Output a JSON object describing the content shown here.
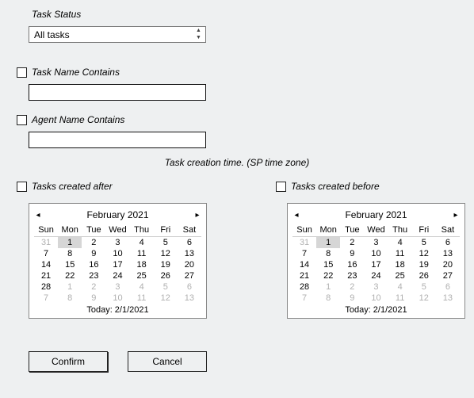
{
  "filters": {
    "task_status_label": "Task Status",
    "task_status_value": "All tasks",
    "task_name_contains_label": "Task Name Contains",
    "task_name_contains_value": "",
    "agent_name_contains_label": "Agent Name Contains",
    "agent_name_contains_value": "",
    "creation_time_caption": "Task creation time. (SP time zone)",
    "created_after_label": "Tasks created after",
    "created_before_label": "Tasks created before"
  },
  "calendar_after": {
    "title": "February 2021",
    "weekdays": [
      "Sun",
      "Mon",
      "Tue",
      "Wed",
      "Thu",
      "Fri",
      "Sat"
    ],
    "days": [
      {
        "n": "31",
        "other": true
      },
      {
        "n": "1",
        "sel": true
      },
      {
        "n": "2"
      },
      {
        "n": "3"
      },
      {
        "n": "4"
      },
      {
        "n": "5"
      },
      {
        "n": "6"
      },
      {
        "n": "7"
      },
      {
        "n": "8"
      },
      {
        "n": "9"
      },
      {
        "n": "10"
      },
      {
        "n": "11"
      },
      {
        "n": "12"
      },
      {
        "n": "13"
      },
      {
        "n": "14"
      },
      {
        "n": "15"
      },
      {
        "n": "16"
      },
      {
        "n": "17"
      },
      {
        "n": "18"
      },
      {
        "n": "19"
      },
      {
        "n": "20"
      },
      {
        "n": "21"
      },
      {
        "n": "22"
      },
      {
        "n": "23"
      },
      {
        "n": "24"
      },
      {
        "n": "25"
      },
      {
        "n": "26"
      },
      {
        "n": "27"
      },
      {
        "n": "28"
      },
      {
        "n": "1",
        "other": true
      },
      {
        "n": "2",
        "other": true
      },
      {
        "n": "3",
        "other": true
      },
      {
        "n": "4",
        "other": true
      },
      {
        "n": "5",
        "other": true
      },
      {
        "n": "6",
        "other": true
      },
      {
        "n": "7",
        "other": true
      },
      {
        "n": "8",
        "other": true
      },
      {
        "n": "9",
        "other": true
      },
      {
        "n": "10",
        "other": true
      },
      {
        "n": "11",
        "other": true
      },
      {
        "n": "12",
        "other": true
      },
      {
        "n": "13",
        "other": true
      }
    ],
    "footer": "Today: 2/1/2021"
  },
  "calendar_before": {
    "title": "February 2021",
    "weekdays": [
      "Sun",
      "Mon",
      "Tue",
      "Wed",
      "Thu",
      "Fri",
      "Sat"
    ],
    "days": [
      {
        "n": "31",
        "other": true
      },
      {
        "n": "1",
        "sel": true
      },
      {
        "n": "2"
      },
      {
        "n": "3"
      },
      {
        "n": "4"
      },
      {
        "n": "5"
      },
      {
        "n": "6"
      },
      {
        "n": "7"
      },
      {
        "n": "8"
      },
      {
        "n": "9"
      },
      {
        "n": "10"
      },
      {
        "n": "11"
      },
      {
        "n": "12"
      },
      {
        "n": "13"
      },
      {
        "n": "14"
      },
      {
        "n": "15"
      },
      {
        "n": "16"
      },
      {
        "n": "17"
      },
      {
        "n": "18"
      },
      {
        "n": "19"
      },
      {
        "n": "20"
      },
      {
        "n": "21"
      },
      {
        "n": "22"
      },
      {
        "n": "23"
      },
      {
        "n": "24"
      },
      {
        "n": "25"
      },
      {
        "n": "26"
      },
      {
        "n": "27"
      },
      {
        "n": "28"
      },
      {
        "n": "1",
        "other": true
      },
      {
        "n": "2",
        "other": true
      },
      {
        "n": "3",
        "other": true
      },
      {
        "n": "4",
        "other": true
      },
      {
        "n": "5",
        "other": true
      },
      {
        "n": "6",
        "other": true
      },
      {
        "n": "7",
        "other": true
      },
      {
        "n": "8",
        "other": true
      },
      {
        "n": "9",
        "other": true
      },
      {
        "n": "10",
        "other": true
      },
      {
        "n": "11",
        "other": true
      },
      {
        "n": "12",
        "other": true
      },
      {
        "n": "13",
        "other": true
      }
    ],
    "footer": "Today: 2/1/2021"
  },
  "buttons": {
    "confirm": "Confirm",
    "cancel": "Cancel"
  }
}
